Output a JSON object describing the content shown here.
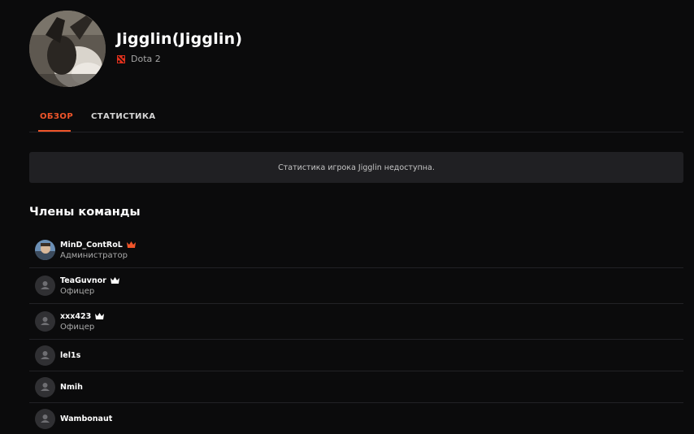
{
  "team": {
    "name": "Jigglin(Jigglin)",
    "game": "Dota 2"
  },
  "tabs": [
    {
      "label": "ОБЗОР",
      "active": true
    },
    {
      "label": "СТАТИСТИКА",
      "active": false
    }
  ],
  "notice": "Статистика игрока Jigglin недоступна.",
  "members_section": {
    "title": "Члены команды",
    "members": [
      {
        "name": "MinD_ContRoL",
        "role": "Администратор",
        "crown_color": "#f0552a",
        "avatar": "photo"
      },
      {
        "name": "TeaGuvnor",
        "role": "Офицер",
        "crown_color": "#ffffff",
        "avatar": "default-user-icon"
      },
      {
        "name": "xxx423",
        "role": "Офицер",
        "crown_color": "#ffffff",
        "avatar": "default-user-icon"
      },
      {
        "name": "lel1s",
        "role": "",
        "avatar": "default-user-icon"
      },
      {
        "name": "Nmih",
        "role": "",
        "avatar": "default-user-icon"
      },
      {
        "name": "Wambonaut",
        "role": "",
        "avatar": "default-user-icon"
      }
    ]
  },
  "colors": {
    "accent": "#f0552a",
    "background": "#0b0b0c",
    "panel": "#202023"
  }
}
